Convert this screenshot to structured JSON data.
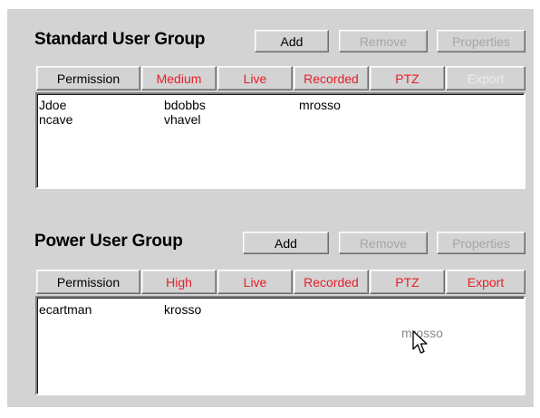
{
  "colors": {
    "panel_bg": "#d3d3d3",
    "active_tab_text": "#e4202a",
    "disabled_text": "#a6a6a6",
    "label_text": "#000000"
  },
  "standard": {
    "title": "Standard User Group",
    "buttons": {
      "add": "Add",
      "remove": "Remove",
      "properties": "Properties"
    },
    "tabs": {
      "permission": "Permission",
      "level": "Medium",
      "live": "Live",
      "recorded": "Recorded",
      "ptz": "PTZ",
      "export": "Export"
    },
    "users": [
      "Jdoe",
      "ncave",
      "bdobbs",
      "vhavel",
      "mrosso"
    ]
  },
  "power": {
    "title": "Power User Group",
    "buttons": {
      "add": "Add",
      "remove": "Remove",
      "properties": "Properties"
    },
    "tabs": {
      "permission": "Permission",
      "level": "High",
      "live": "Live",
      "recorded": "Recorded",
      "ptz": "PTZ",
      "export": "Export"
    },
    "users": [
      "ecartman",
      "krosso"
    ],
    "dragging_user": "mrosso"
  },
  "cursor_icon": "arrow-pointer-icon"
}
